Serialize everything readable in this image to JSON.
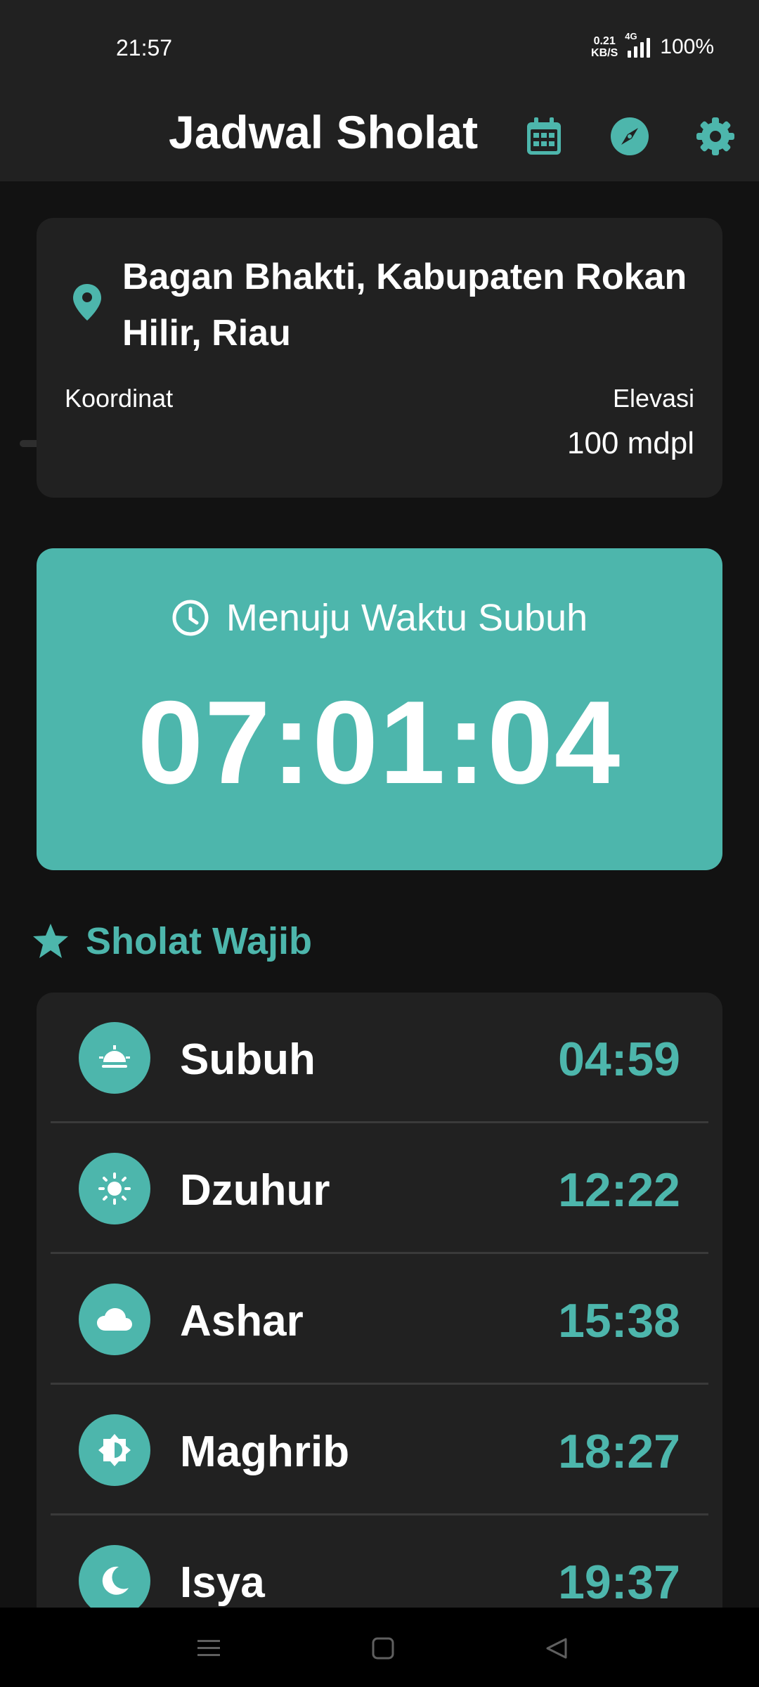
{
  "status_bar": {
    "time": "21:57",
    "net_speed_value": "0.21",
    "net_speed_unit": "KB/S",
    "network_type": "4G",
    "battery": "100%"
  },
  "app_bar": {
    "title": "Jadwal Sholat",
    "actions": [
      {
        "name": "calendar-icon"
      },
      {
        "name": "compass-icon"
      },
      {
        "name": "settings-gear-icon"
      }
    ]
  },
  "location": {
    "name": "Bagan Bhakti, Kabupaten Rokan Hilir, Riau",
    "coordinates_label": "Koordinat",
    "elevation_label": "Elevasi",
    "elevation_value": "100 mdpl"
  },
  "countdown": {
    "title": "Menuju Waktu Subuh",
    "value": "07:01:04"
  },
  "section": {
    "title": "Sholat Wajib"
  },
  "prayers": [
    {
      "name": "Subuh",
      "time": "04:59",
      "icon": "sunrise-icon"
    },
    {
      "name": "Dzuhur",
      "time": "12:22",
      "icon": "sun-icon"
    },
    {
      "name": "Ashar",
      "time": "15:38",
      "icon": "cloud-icon"
    },
    {
      "name": "Maghrib",
      "time": "18:27",
      "icon": "brightness-icon"
    },
    {
      "name": "Isya",
      "time": "19:37",
      "icon": "moon-icon"
    }
  ],
  "colors": {
    "accent": "#4db6ac",
    "background": "#121212",
    "surface": "#212121"
  }
}
